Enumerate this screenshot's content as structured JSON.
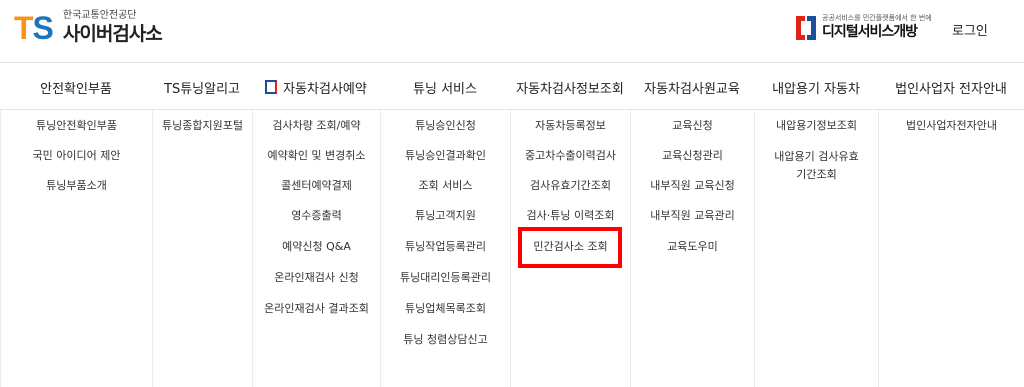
{
  "header": {
    "logo_ts_t": "T",
    "logo_ts_s": "S",
    "logo_sub": "한국교통안전공단",
    "logo_main": "사이버검사소",
    "gov_sub": "공공서비스를 민간플랫폼에서 한 번에",
    "gov_main": "디지털서비스개방",
    "login": "로그인"
  },
  "nav": [
    {
      "label": "안전확인부품"
    },
    {
      "label": "TS튜닝알리고"
    },
    {
      "label": "자동차검사예약"
    },
    {
      "label": "튜닝 서비스"
    },
    {
      "label": "자동차검사정보조회"
    },
    {
      "label": "자동차검사원교육"
    },
    {
      "label": "내압용기 자동차"
    },
    {
      "label": "법인사업자 전자안내"
    }
  ],
  "menus": [
    [
      "튜닝안전확인부품",
      "국민 아이디어 제안",
      "튜닝부품소개"
    ],
    [
      "튜닝종합지원포털"
    ],
    [
      "검사차량 조회/예약",
      "예약확인 및 변경취소",
      "콜센터예약결제",
      "영수증출력",
      "예약신청 Q&A",
      "온라인재검사 신청",
      "온라인재검사 결과조회"
    ],
    [
      "튜닝승인신청",
      "튜닝승인결과확인",
      "조회 서비스",
      "튜닝고객지원",
      "튜닝작업등록관리",
      "튜닝대리인등록관리",
      "튜닝업체목록조회",
      "튜닝 청렴상담신고"
    ],
    [
      "자동차등록정보",
      "중고차수출이력검사",
      "검사유효기간조회",
      "검사·튜닝 이력조회",
      "민간검사소 조회"
    ],
    [
      "교육신청",
      "교육신청관리",
      "내부직원 교육신청",
      "내부직원 교육관리",
      "교육도우미"
    ],
    [
      "내압용기정보조회",
      "내압용기 검사유효기간조회"
    ],
    [
      "법인사업자전자안내"
    ]
  ],
  "colors": {
    "accent_orange": "#f7941d",
    "accent_blue": "#1b75bc",
    "highlight_red": "#ff0000"
  }
}
